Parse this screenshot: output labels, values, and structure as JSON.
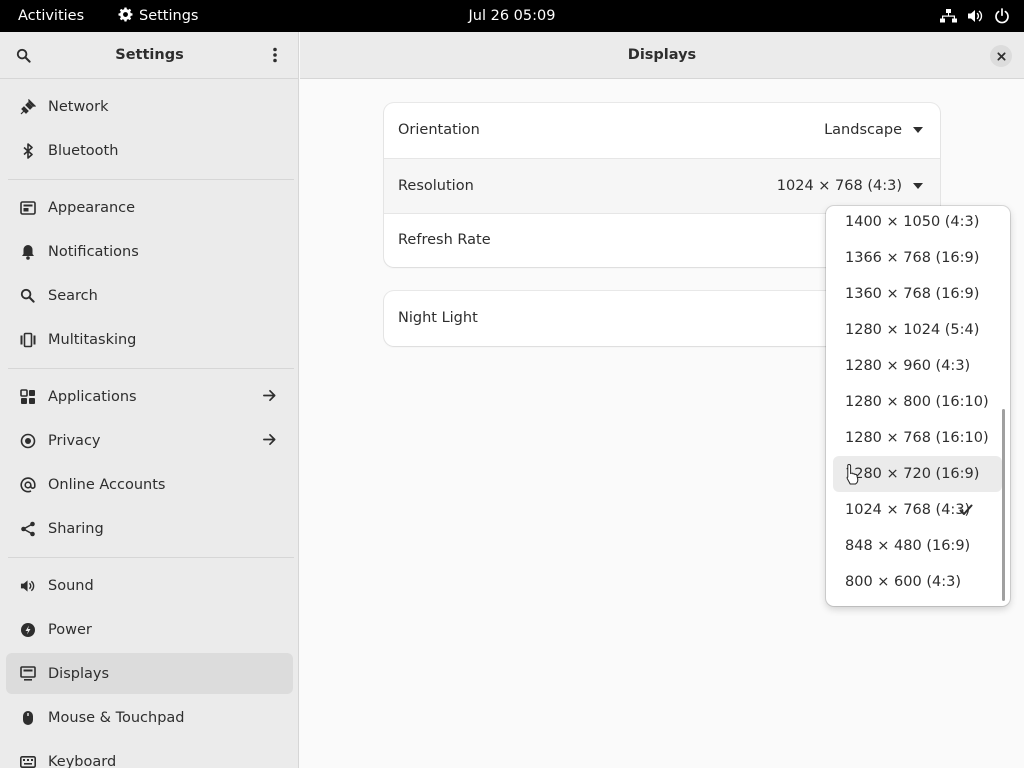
{
  "topbar": {
    "activities": "Activities",
    "app_name": "Settings",
    "clock": "Jul 26  05:09",
    "tray_icons": [
      "network-wired-icon",
      "volume-icon",
      "power-icon"
    ]
  },
  "sidebar": {
    "title": "Settings",
    "items": [
      {
        "label": "Network",
        "icon": "network-icon"
      },
      {
        "label": "Bluetooth",
        "icon": "bluetooth-icon"
      },
      {
        "label": "Appearance",
        "icon": "appearance-icon"
      },
      {
        "label": "Notifications",
        "icon": "bell-icon"
      },
      {
        "label": "Search",
        "icon": "search-icon"
      },
      {
        "label": "Multitasking",
        "icon": "multitasking-icon"
      },
      {
        "label": "Applications",
        "icon": "apps-grid-icon"
      },
      {
        "label": "Privacy",
        "icon": "privacy-icon"
      },
      {
        "label": "Online Accounts",
        "icon": "at-sign-icon"
      },
      {
        "label": "Sharing",
        "icon": "share-icon"
      },
      {
        "label": "Sound",
        "icon": "speaker-icon"
      },
      {
        "label": "Power",
        "icon": "power-icon"
      },
      {
        "label": "Displays",
        "icon": "display-icon"
      },
      {
        "label": "Mouse & Touchpad",
        "icon": "mouse-icon"
      },
      {
        "label": "Keyboard",
        "icon": "keyboard-icon"
      }
    ],
    "active": "Displays"
  },
  "main": {
    "title": "Displays",
    "orientation": {
      "label": "Orientation",
      "value": "Landscape"
    },
    "resolution": {
      "label": "Resolution",
      "value": "1024 × 768 (4:3)"
    },
    "refresh_rate": {
      "label": "Refresh Rate"
    },
    "night_light": {
      "label": "Night Light"
    }
  },
  "resolution_menu": {
    "options": [
      "1400 × 1050 (4:3)",
      "1366 × 768 (16:9)",
      "1360 × 768 (16:9)",
      "1280 × 1024 (5:4)",
      "1280 × 960 (4:3)",
      "1280 × 800 (16:10)",
      "1280 × 768 (16:10)",
      "1280 × 720 (16:9)",
      "1024 × 768 (4:3)",
      "848 × 480 (16:9)",
      "800 × 600 (4:3)"
    ],
    "selected": "1024 × 768 (4:3)",
    "hovered": "1280 × 720 (16:9)"
  },
  "colors": {
    "topbar_bg": "#000000",
    "sidebar_bg": "#ebebeb",
    "content_bg": "#fafafa",
    "active_item_bg": "#dcdcdc",
    "text": "#2e2e2e"
  }
}
